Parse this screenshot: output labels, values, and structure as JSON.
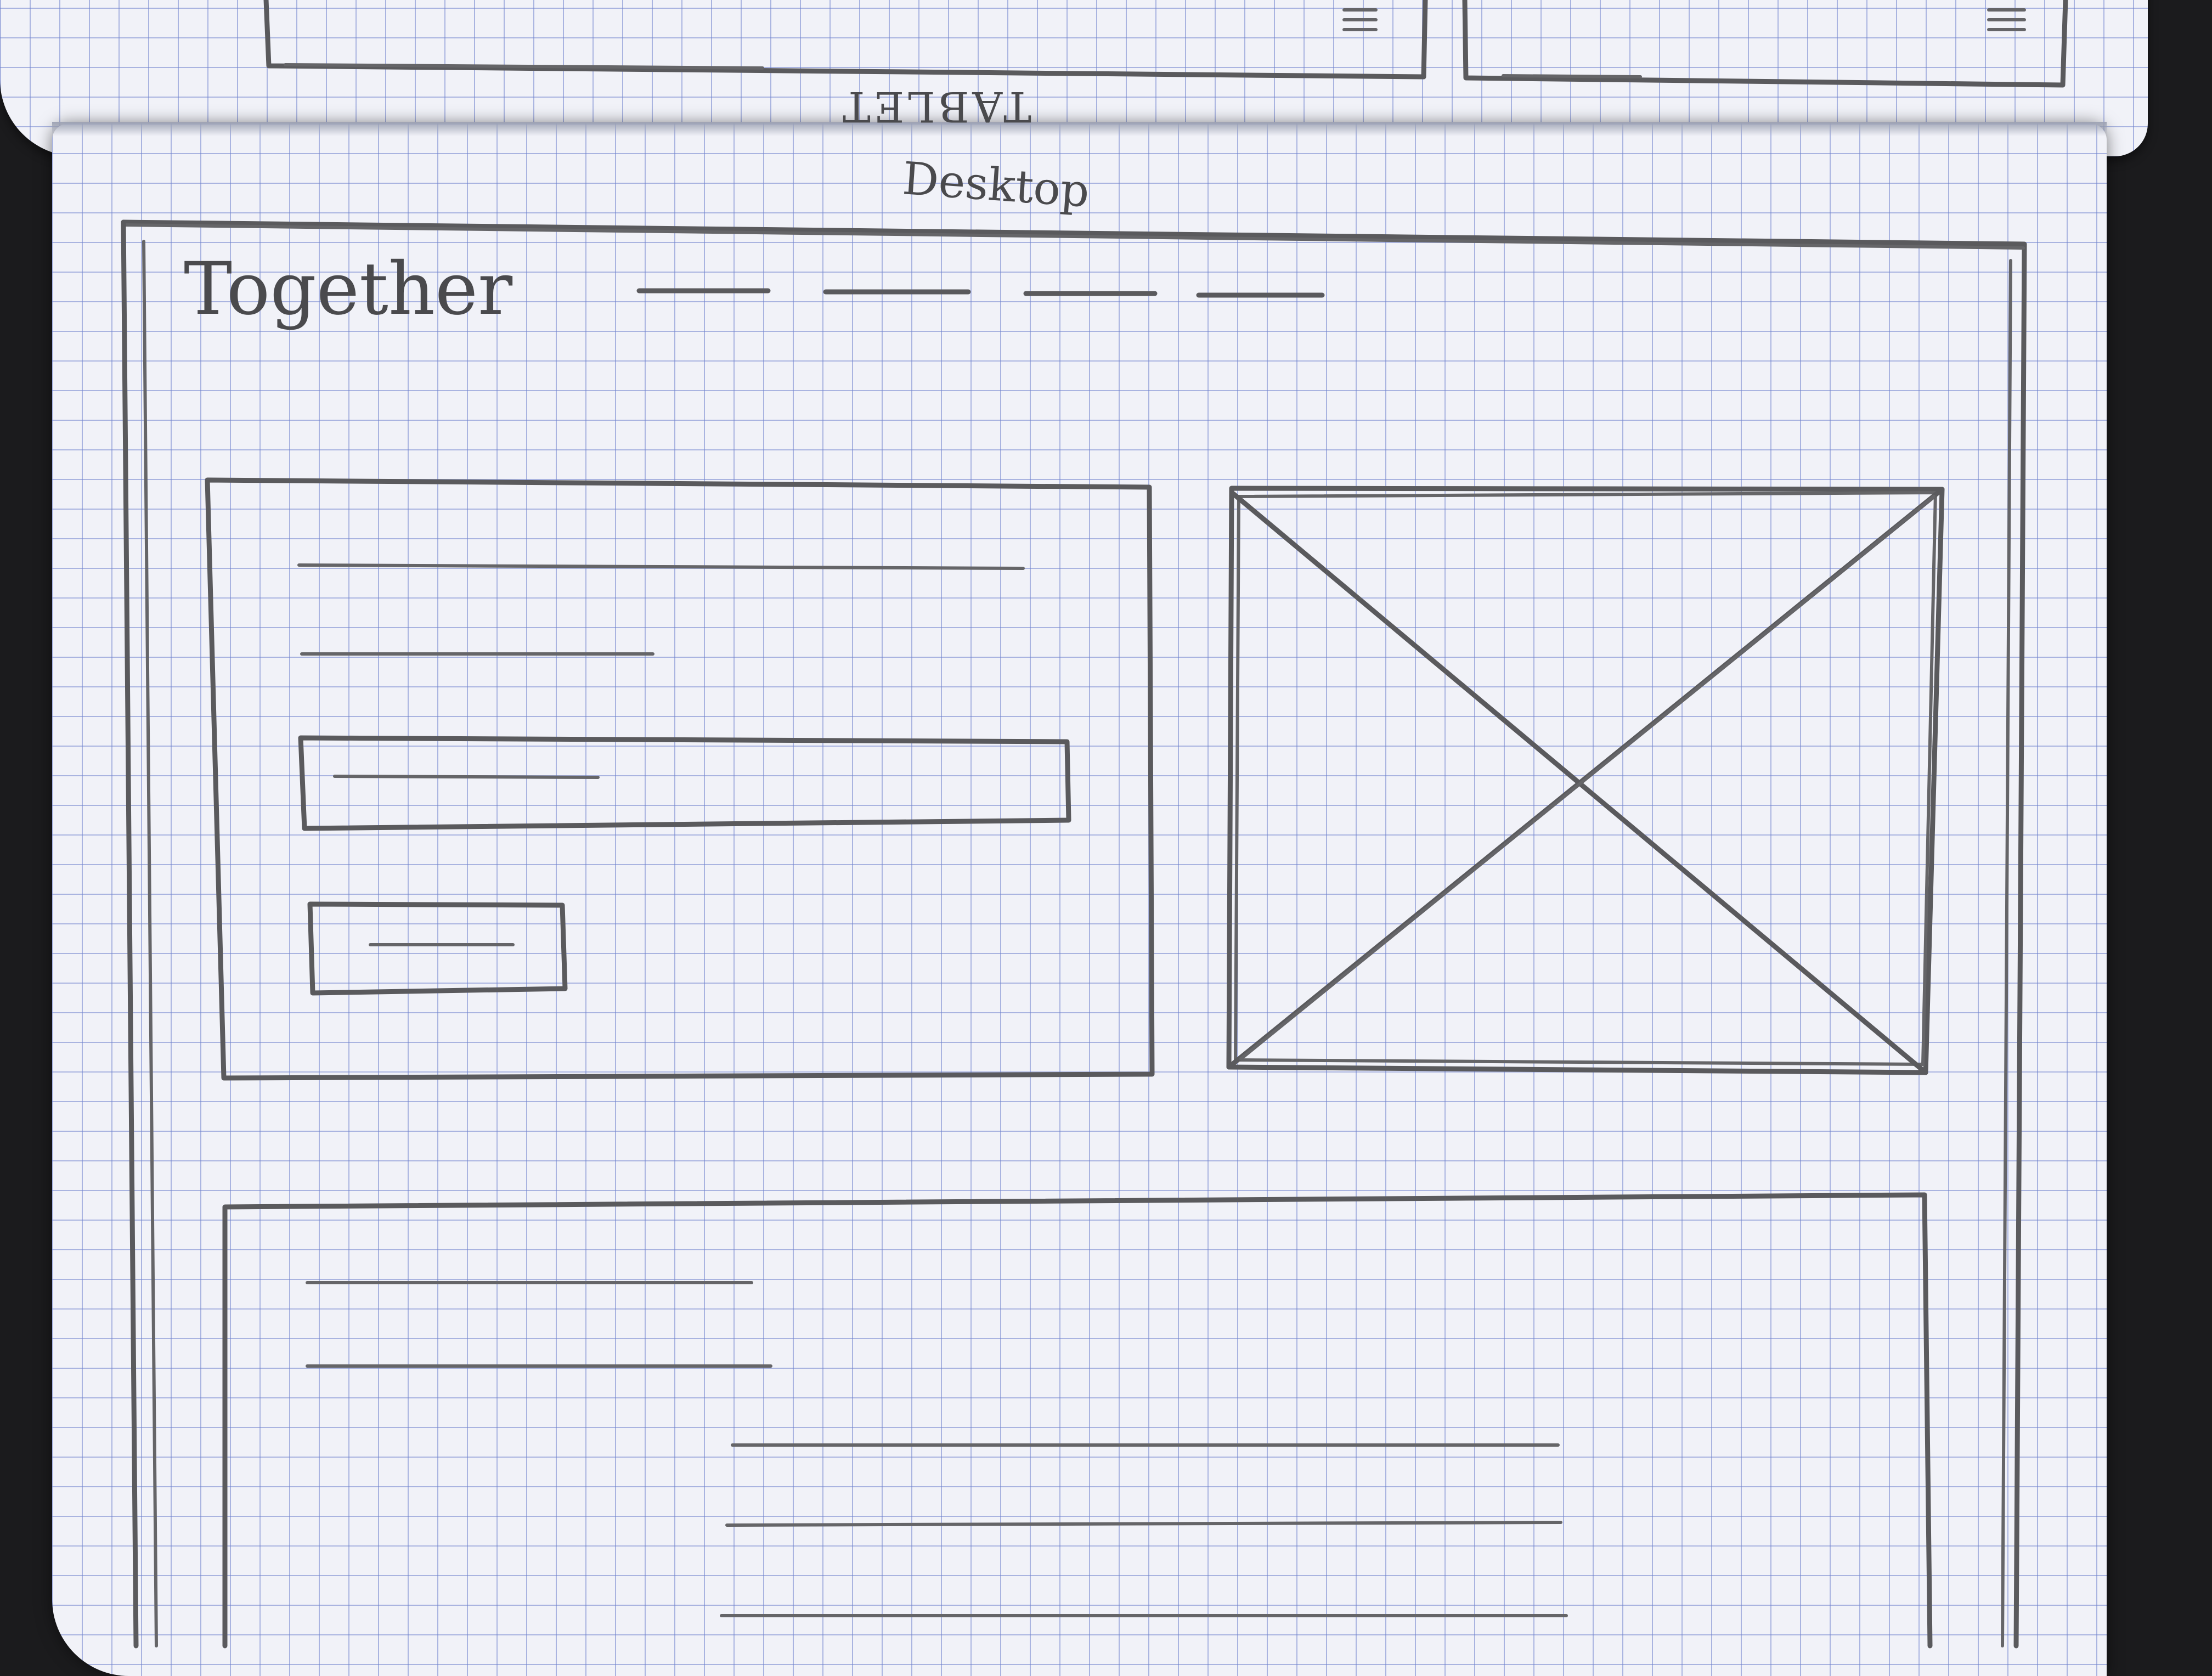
{
  "sketch": {
    "previous_page_label": "TABLET",
    "page_label": "Desktop",
    "header": {
      "logo_text": "Together"
    }
  }
}
